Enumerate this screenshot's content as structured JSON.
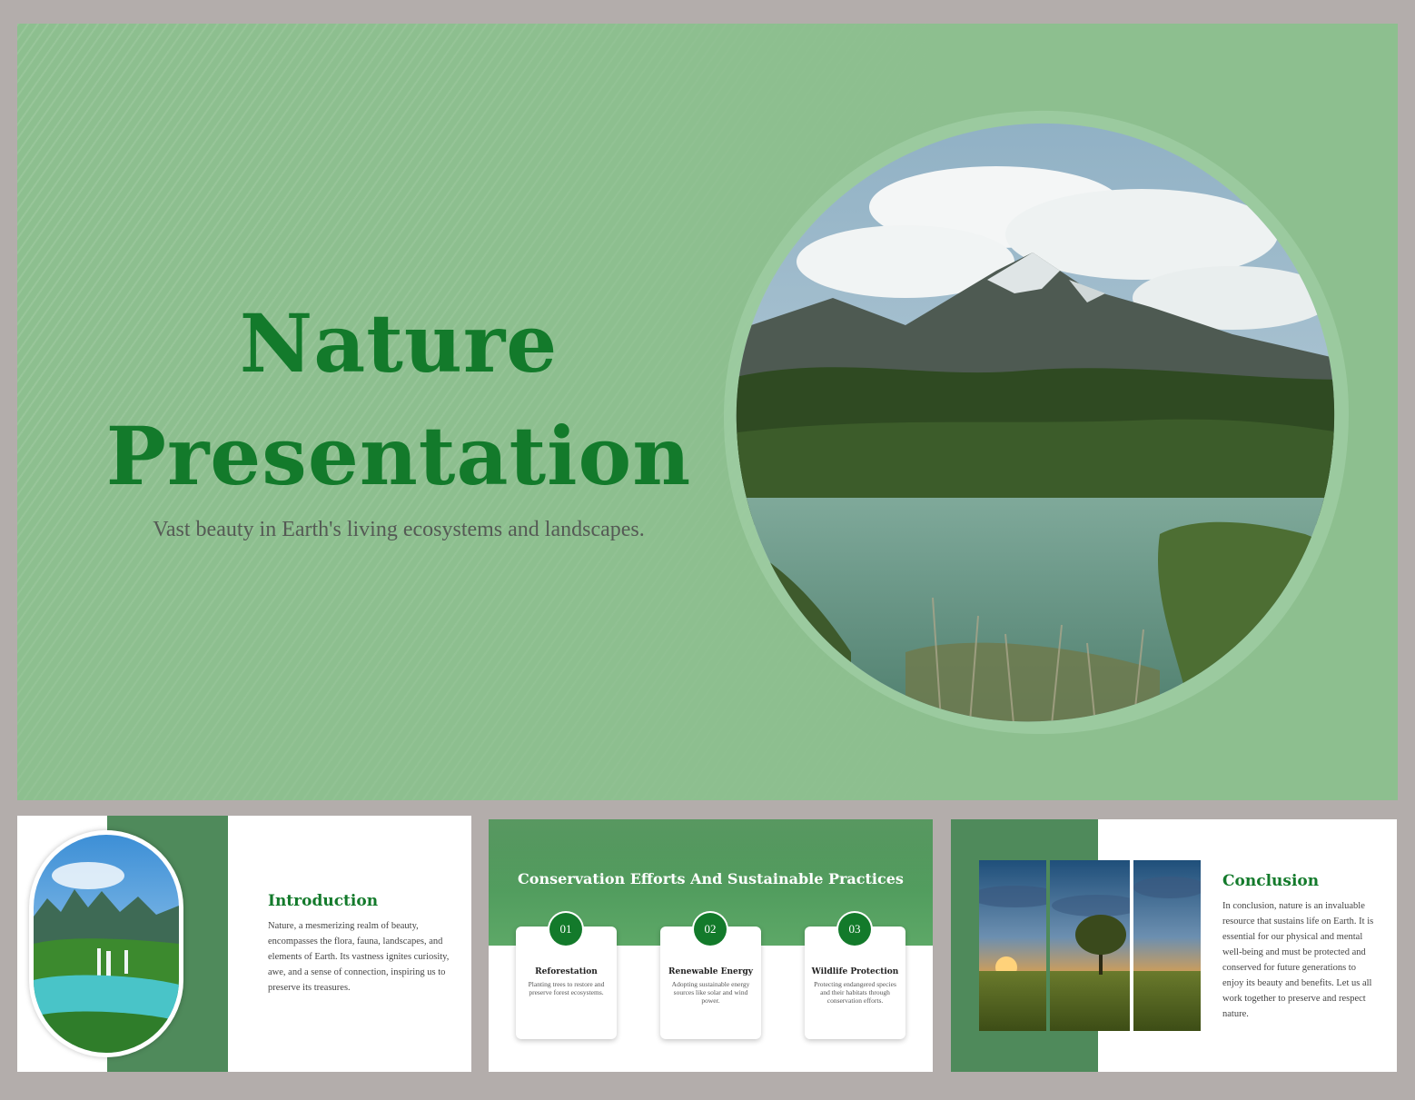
{
  "hero": {
    "title_line1": "Nature",
    "title_line2": "Presentation",
    "subtitle": "Vast beauty in Earth's living ecosystems and landscapes."
  },
  "intro": {
    "heading": "Introduction",
    "body": "Nature, a mesmerizing realm of beauty, encompasses the flora, fauna, landscapes, and elements of Earth. Its vastness ignites curiosity, awe, and a sense of connection, inspiring us to preserve its treasures."
  },
  "conservation": {
    "heading": "Conservation Efforts And Sustainable Practices",
    "cards": [
      {
        "number": "01",
        "title": "Reforestation",
        "body": "Planting trees to restore and preserve forest ecosystems."
      },
      {
        "number": "02",
        "title": "Renewable Energy",
        "body": "Adopting sustainable energy sources like solar and wind power."
      },
      {
        "number": "03",
        "title": "Wildlife Protection",
        "body": "Protecting endangered species and their habitats through conservation efforts."
      }
    ]
  },
  "conclusion": {
    "heading": "Conclusion",
    "body": "In conclusion, nature is an invaluable resource that sustains life on Earth. It is essential for our physical and mental well-being and must be protected and conserved for future generations to enjoy its beauty and benefits. Let us all work together to preserve and respect nature."
  },
  "colors": {
    "accent_green": "#137a2b",
    "slide_bg_green": "#8dbf8f",
    "band_green": "#4f8a5b",
    "frame_gray": "#b3adab"
  },
  "images": {
    "hero": "mountain-lake-photo",
    "intro": "waterfall-valley-photo",
    "conservation": "forest-background-photo",
    "conclusion": "sunset-tree-photo"
  }
}
